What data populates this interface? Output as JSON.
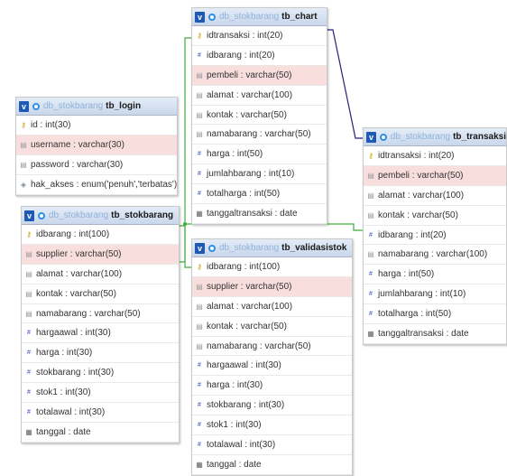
{
  "tables": {
    "tb_chart": {
      "db": "db_stokbarang",
      "name": "tb_chart",
      "columns": [
        {
          "text": "idtransaksi : int(20)",
          "icon": "key",
          "fk": false
        },
        {
          "text": "idbarang : int(20)",
          "icon": "num",
          "fk": false
        },
        {
          "text": "pembeli : varchar(50)",
          "icon": "str",
          "fk": true
        },
        {
          "text": "alamat : varchar(100)",
          "icon": "str",
          "fk": false
        },
        {
          "text": "kontak : varchar(50)",
          "icon": "str",
          "fk": false
        },
        {
          "text": "namabarang : varchar(50)",
          "icon": "str",
          "fk": false
        },
        {
          "text": "harga : int(50)",
          "icon": "num",
          "fk": false
        },
        {
          "text": "jumlahbarang : int(10)",
          "icon": "num",
          "fk": false
        },
        {
          "text": "totalharga : int(50)",
          "icon": "num",
          "fk": false
        },
        {
          "text": "tanggaltransaksi : date",
          "icon": "date",
          "fk": false
        }
      ]
    },
    "tb_login": {
      "db": "db_stokbarang",
      "name": "tb_login",
      "columns": [
        {
          "text": "id : int(30)",
          "icon": "key",
          "fk": false
        },
        {
          "text": "username : varchar(30)",
          "icon": "str",
          "fk": true
        },
        {
          "text": "password : varchar(30)",
          "icon": "str",
          "fk": false
        },
        {
          "text": "hak_akses : enum('penuh','terbatas')",
          "icon": "enum",
          "fk": false
        }
      ]
    },
    "tb_stokbarang": {
      "db": "db_stokbarang",
      "name": "tb_stokbarang",
      "columns": [
        {
          "text": "idbarang : int(100)",
          "icon": "key",
          "fk": false
        },
        {
          "text": "supplier : varchar(50)",
          "icon": "str",
          "fk": true
        },
        {
          "text": "alamat : varchar(100)",
          "icon": "str",
          "fk": false
        },
        {
          "text": "kontak : varchar(50)",
          "icon": "str",
          "fk": false
        },
        {
          "text": "namabarang : varchar(50)",
          "icon": "str",
          "fk": false
        },
        {
          "text": "hargaawal : int(30)",
          "icon": "num",
          "fk": false
        },
        {
          "text": "harga : int(30)",
          "icon": "num",
          "fk": false
        },
        {
          "text": "stokbarang : int(30)",
          "icon": "num",
          "fk": false
        },
        {
          "text": "stok1 : int(30)",
          "icon": "num",
          "fk": false
        },
        {
          "text": "totalawal : int(30)",
          "icon": "num",
          "fk": false
        },
        {
          "text": "tanggal : date",
          "icon": "date",
          "fk": false
        }
      ]
    },
    "tb_validasistok": {
      "db": "db_stokbarang",
      "name": "tb_validasistok",
      "columns": [
        {
          "text": "idbarang : int(100)",
          "icon": "key",
          "fk": false
        },
        {
          "text": "supplier : varchar(50)",
          "icon": "str",
          "fk": true
        },
        {
          "text": "alamat : varchar(100)",
          "icon": "str",
          "fk": false
        },
        {
          "text": "kontak : varchar(50)",
          "icon": "str",
          "fk": false
        },
        {
          "text": "namabarang : varchar(50)",
          "icon": "str",
          "fk": false
        },
        {
          "text": "hargaawal : int(30)",
          "icon": "num",
          "fk": false
        },
        {
          "text": "harga : int(30)",
          "icon": "num",
          "fk": false
        },
        {
          "text": "stokbarang : int(30)",
          "icon": "num",
          "fk": false
        },
        {
          "text": "stok1 : int(30)",
          "icon": "num",
          "fk": false
        },
        {
          "text": "totalawal : int(30)",
          "icon": "num",
          "fk": false
        },
        {
          "text": "tanggal : date",
          "icon": "date",
          "fk": false
        }
      ]
    },
    "tb_transaksi": {
      "db": "db_stokbarang",
      "name": "tb_transaksi",
      "columns": [
        {
          "text": "idtransaksi : int(20)",
          "icon": "key",
          "fk": false
        },
        {
          "text": "pembeli : varchar(50)",
          "icon": "str",
          "fk": true
        },
        {
          "text": "alamat : varchar(100)",
          "icon": "str",
          "fk": false
        },
        {
          "text": "kontak : varchar(50)",
          "icon": "str",
          "fk": false
        },
        {
          "text": "idbarang : int(20)",
          "icon": "num",
          "fk": false
        },
        {
          "text": "namabarang : varchar(100)",
          "icon": "str",
          "fk": false
        },
        {
          "text": "harga : int(50)",
          "icon": "num",
          "fk": false
        },
        {
          "text": "jumlahbarang : int(10)",
          "icon": "num",
          "fk": false
        },
        {
          "text": "totalharga : int(50)",
          "icon": "num",
          "fk": false
        },
        {
          "text": "tanggaltransaksi : date",
          "icon": "date",
          "fk": false
        }
      ]
    }
  },
  "toggle_label": "v",
  "colors": {
    "relation_green": "#3fae3f",
    "relation_navy": "#23237a",
    "header_accent": "#1e5ab4"
  }
}
